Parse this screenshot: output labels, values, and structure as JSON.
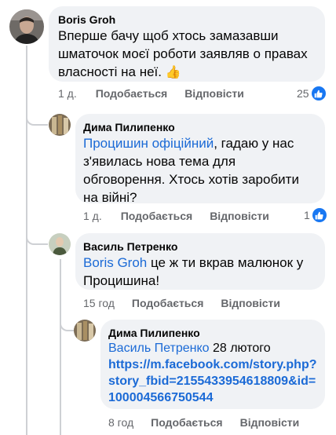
{
  "comments": [
    {
      "author": "Boris  Groh",
      "text": "Вперше бачу щоб хтось замазавши шматочок моєї роботи заявляв о правах власності на неї.",
      "emoji": "👍",
      "time": "1 д.",
      "like_label": "Подобається",
      "reply_label": "Відповісти",
      "reaction_count": "25"
    },
    {
      "author": "Дима Пилипенко",
      "mention": "Процишин офіційний",
      "text": ", гадаю у нас з'явилась нова тема для обговорення. Хтось хотів заробити на війні?",
      "time": "1 д.",
      "like_label": "Подобається",
      "reply_label": "Відповісти",
      "reaction_count": "1"
    },
    {
      "author": "Василь Петренко",
      "mention": "Boris  Groh",
      "text": " це ж ти вкрав малюнок у Процишина!",
      "time": "15 год",
      "like_label": "Подобається",
      "reply_label": "Відповісти"
    },
    {
      "author": "Дима Пилипенко",
      "mention": "Василь Петренко",
      "text": " 28 лютого",
      "link": "https://m.facebook.com/story.php?story_fbid=2155433954618809&id=100004566750544",
      "time": "8 год",
      "like_label": "Подобається",
      "reply_label": "Відповісти"
    }
  ],
  "colors": {
    "bubble": "#f0f2f5",
    "mention": "#1b6ad6",
    "meta": "#65676b",
    "like": "#1877f2",
    "thread_line": "#ced0d4"
  },
  "icons": {
    "like": "thumbs-up-icon",
    "emoji": "thumbs-up-emoji"
  }
}
